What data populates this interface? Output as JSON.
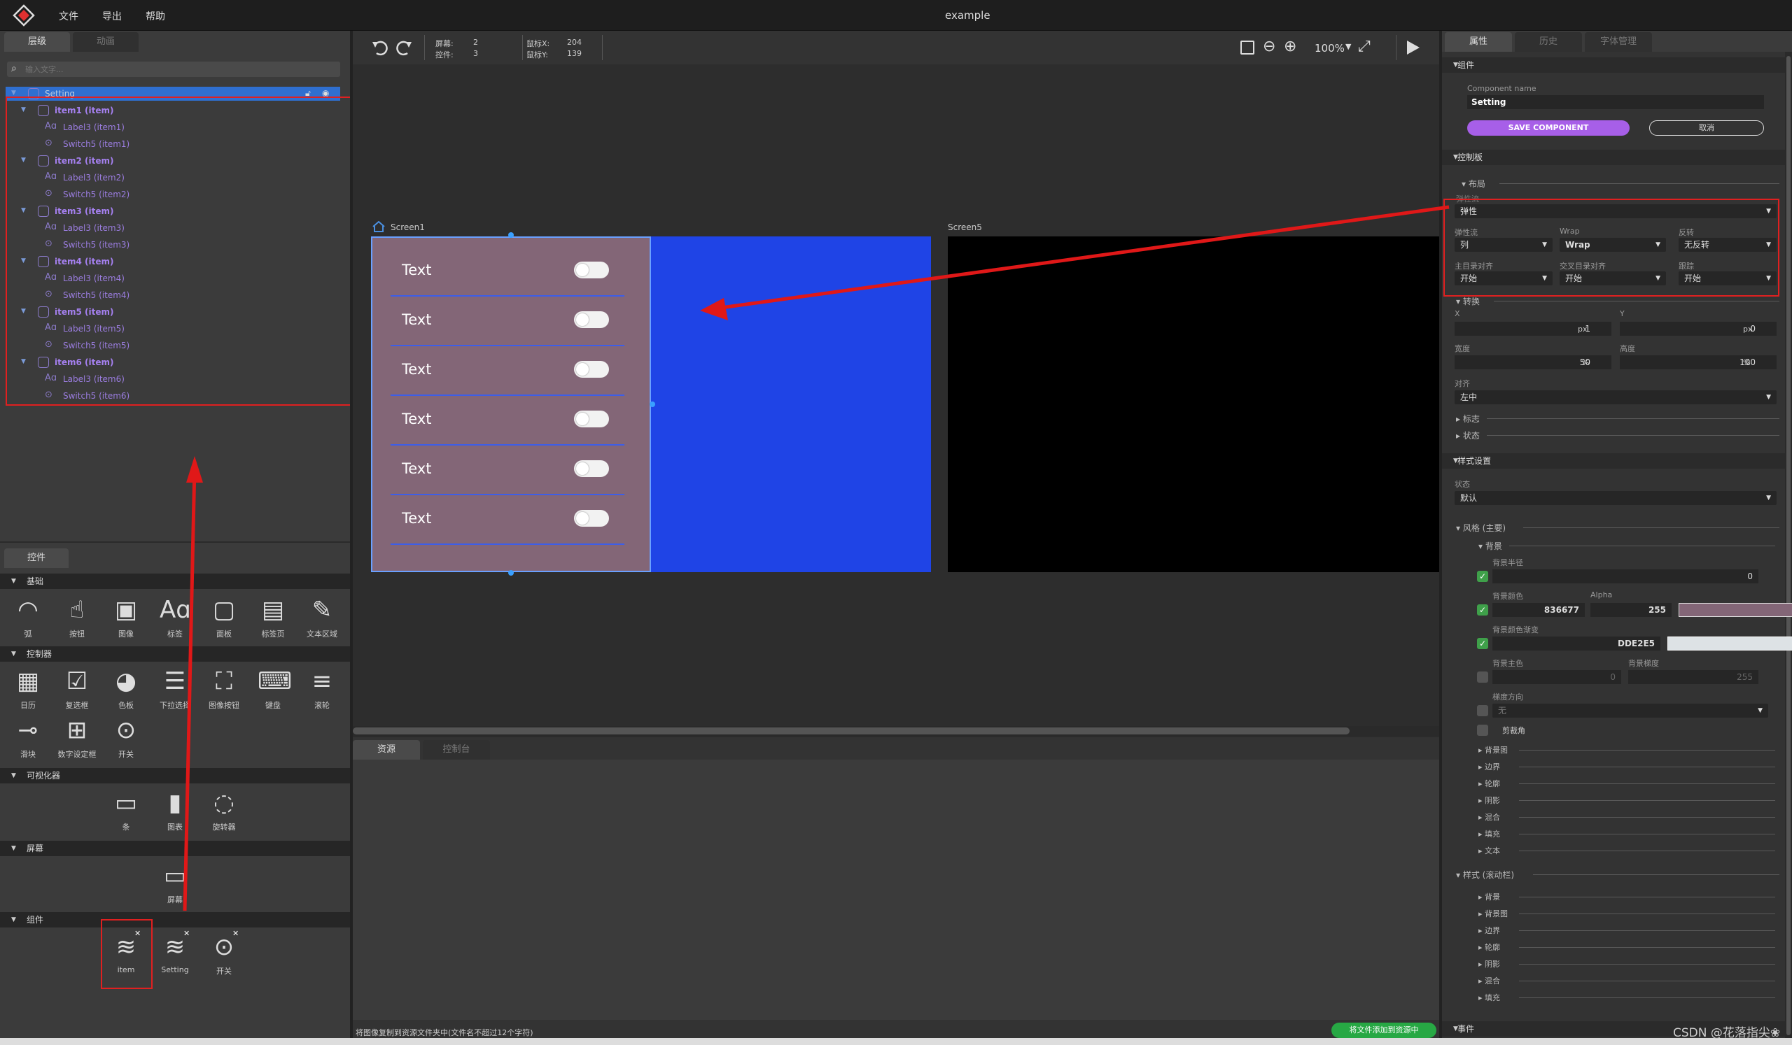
{
  "menubar": {
    "items": [
      "文件",
      "导出",
      "帮助"
    ],
    "title": "example"
  },
  "left": {
    "tabs": [
      "层级",
      "动画"
    ],
    "search_placeholder": "输入文字...",
    "tree": [
      {
        "label": "Setting",
        "level": 0,
        "kind": "obj"
      },
      {
        "label": "item1 (item)",
        "level": 1,
        "kind": "obj"
      },
      {
        "label": "Label3 (item1)",
        "level": 2,
        "kind": "label"
      },
      {
        "label": "Switch5 (item1)",
        "level": 2,
        "kind": "switch"
      },
      {
        "label": "item2 (item)",
        "level": 1,
        "kind": "obj"
      },
      {
        "label": "Label3 (item2)",
        "level": 2,
        "kind": "label"
      },
      {
        "label": "Switch5 (item2)",
        "level": 2,
        "kind": "switch"
      },
      {
        "label": "item3 (item)",
        "level": 1,
        "kind": "obj"
      },
      {
        "label": "Label3 (item3)",
        "level": 2,
        "kind": "label"
      },
      {
        "label": "Switch5 (item3)",
        "level": 2,
        "kind": "switch"
      },
      {
        "label": "item4 (item)",
        "level": 1,
        "kind": "obj"
      },
      {
        "label": "Label3 (item4)",
        "level": 2,
        "kind": "label"
      },
      {
        "label": "Switch5 (item4)",
        "level": 2,
        "kind": "switch"
      },
      {
        "label": "item5 (item)",
        "level": 1,
        "kind": "obj"
      },
      {
        "label": "Label3 (item5)",
        "level": 2,
        "kind": "label"
      },
      {
        "label": "Switch5 (item5)",
        "level": 2,
        "kind": "switch"
      },
      {
        "label": "item6 (item)",
        "level": 1,
        "kind": "obj"
      },
      {
        "label": "Label3 (item6)",
        "level": 2,
        "kind": "label"
      },
      {
        "label": "Switch5 (item6)",
        "level": 2,
        "kind": "switch"
      }
    ],
    "widgets_tab": "控件",
    "cats": {
      "basic": {
        "title": "基础",
        "items": [
          "弧",
          "按钮",
          "图像",
          "标签",
          "面板",
          "标签页",
          "文本区域"
        ]
      },
      "ctrl": {
        "title": "控制器",
        "items": [
          "日历",
          "复选框",
          "色板",
          "下拉选择",
          "图像按钮",
          "键盘",
          "滚轮",
          "滑块",
          "数字设定框",
          "开关"
        ]
      },
      "vis": {
        "title": "可视化器",
        "items": [
          "条",
          "图表",
          "旋转器"
        ]
      },
      "screen": {
        "title": "屏幕",
        "items": [
          "屏幕"
        ]
      },
      "comp": {
        "title": "组件",
        "items": [
          "item",
          "Setting",
          "开关"
        ]
      }
    }
  },
  "toolbar": {
    "screens_label": "屏幕:",
    "screens": "2",
    "widgets_label": "控件:",
    "widgets": "3",
    "mx_label": "鼠标X:",
    "mx": "204",
    "my_label": "鼠标Y:",
    "my": "139",
    "zoom": "100%"
  },
  "canvas": {
    "screen1": "Screen1",
    "screen5": "Screen5",
    "rows": [
      "Text",
      "Text",
      "Text",
      "Text",
      "Text",
      "Text"
    ]
  },
  "bottom": {
    "tabs": [
      "资源",
      "控制台"
    ],
    "status": "将图像复制到资源文件夹中(文件名不超过12个字符)",
    "button": "将文件添加到资源中"
  },
  "right": {
    "tabs": [
      "属性",
      "历史",
      "字体管理"
    ],
    "comp_header": "组件",
    "comp_name_label": "Component name",
    "comp_name": "Setting",
    "save": "SAVE COMPONENT",
    "cancel": "取消",
    "ctrl_header": "控制板",
    "layout": "布局",
    "flex_label": "弹性流",
    "flex_val": "弹性",
    "flow_label": "弹性流",
    "flow_val": "列",
    "wrap_label": "Wrap",
    "wrap_val": "Wrap",
    "rev_label": "反转",
    "rev_val": "无反转",
    "main_label": "主目录对齐",
    "main_val": "开始",
    "cross_label": "交叉目录对齐",
    "cross_val": "开始",
    "track_label": "跟踪",
    "track_val": "开始",
    "transform": "转换",
    "x_label": "X",
    "x_val": "1",
    "x_unit": "px",
    "y_label": "Y",
    "y_val": "0",
    "y_unit": "px",
    "w_label": "宽度",
    "w_val": "50",
    "w_unit": "%",
    "h_label": "高度",
    "h_val": "100",
    "h_unit": "%",
    "align_label": "对齐",
    "align_val": "左中",
    "flags": "标志",
    "states": "状态",
    "style_header": "样式设置",
    "state_label": "状态",
    "state_val": "默认",
    "main_style": "风格 (主要)",
    "bg": "背景",
    "radius_label": "背景半径",
    "radius_val": "0",
    "bgcolor_label": "背景颜色",
    "bgcolor_val": "836677",
    "alpha_label": "Alpha",
    "alpha_val": "255",
    "grad_label": "背景颜色渐变",
    "grad_val": "DDE2E5",
    "mainstop_label": "背景主色",
    "mainstop_val": "0",
    "gradstop_label": "背景梯度",
    "gradstop_val": "255",
    "grad_dir_label": "梯度方向",
    "grad_dir_val": "无",
    "clip": "剪裁角",
    "subs": [
      "背景图",
      "边界",
      "轮廓",
      "阴影",
      "混合",
      "填充",
      "文本"
    ],
    "scroll_style": "样式 (滚动栏)",
    "subs2": [
      "背景",
      "背景图",
      "边界",
      "轮廓",
      "阴影",
      "混合",
      "填充"
    ],
    "events": "事件"
  },
  "watermark": "CSDN @花落指尖❀",
  "colors": {
    "item_bg": "#836677",
    "blue": "#1f44e6",
    "grad": "#DDE2E5"
  }
}
